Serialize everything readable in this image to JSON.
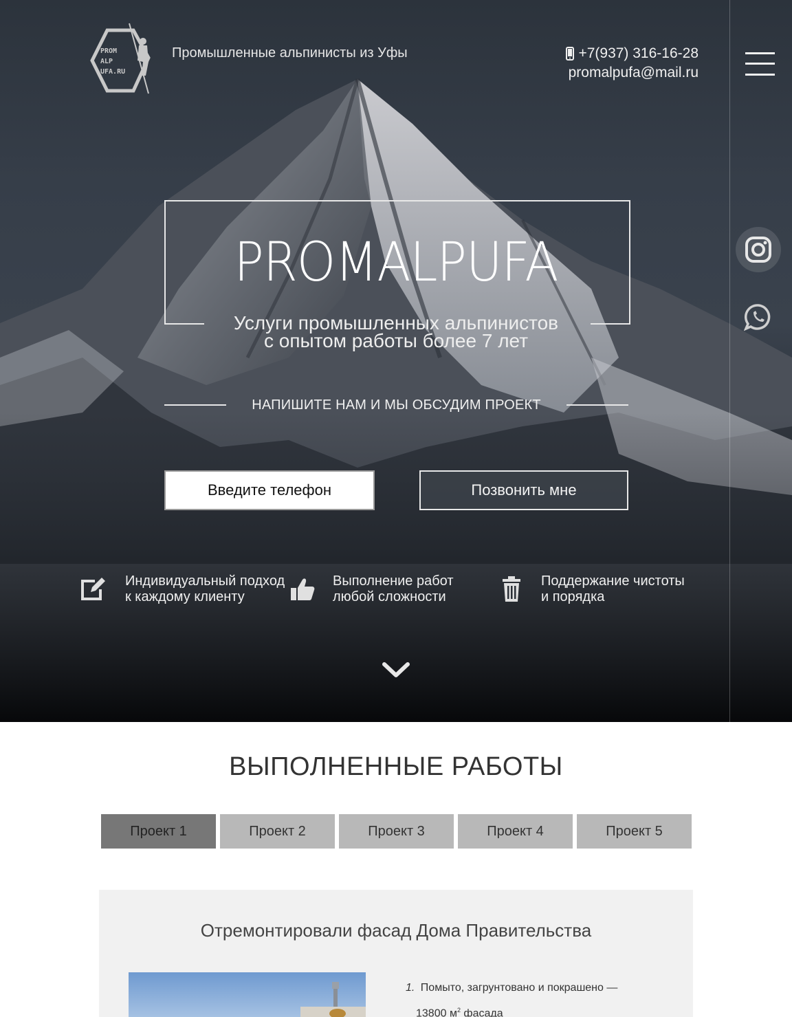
{
  "header": {
    "tagline": "Промышленные альпинисты из Уфы",
    "phone": "+7(937) 316-16-28",
    "email": "promalpufa@mail.ru",
    "logo_lines": [
      "PROM",
      "ALP",
      "UFA.RU"
    ]
  },
  "hero": {
    "brand": "PROMALPUFA",
    "subtitle_line1": "Услуги промышленных альпинистов",
    "subtitle_line2": "с опытом работы более 7 лет",
    "cta": "НАПИШИТЕ НАМ И МЫ ОБСУДИМ ПРОЕКТ",
    "phone_placeholder": "Введите телефон",
    "call_button": "Позвонить мне"
  },
  "features": [
    {
      "icon": "edit-icon",
      "line1": "Индивидуальный подход",
      "line2": "к каждому клиенту"
    },
    {
      "icon": "thumbs-up-icon",
      "line1": "Выполнение работ",
      "line2": "любой сложности"
    },
    {
      "icon": "trash-icon",
      "line1": "Поддержание чистоты",
      "line2": "и порядка"
    }
  ],
  "social": [
    "instagram-icon",
    "whatsapp-icon"
  ],
  "works": {
    "title": "ВЫПОЛНЕННЫЕ РАБОТЫ",
    "tabs": [
      "Проект 1",
      "Проект 2",
      "Проект 3",
      "Проект 4",
      "Проект 5"
    ],
    "active_tab": 0,
    "project": {
      "title": "Отремонтировали фасад Дома Правительства",
      "item1_num": "1.",
      "item1_line1": "Помыто, загрунтовано и покрашено —",
      "item1_line2_prefix": "13800 м",
      "item1_sup": "2",
      "item1_line2_suffix": " фасада"
    }
  },
  "colors": {
    "tab_bg": "#b8b8b8",
    "tab_active_bg": "#777777",
    "panel_bg": "#f1f1f1"
  }
}
